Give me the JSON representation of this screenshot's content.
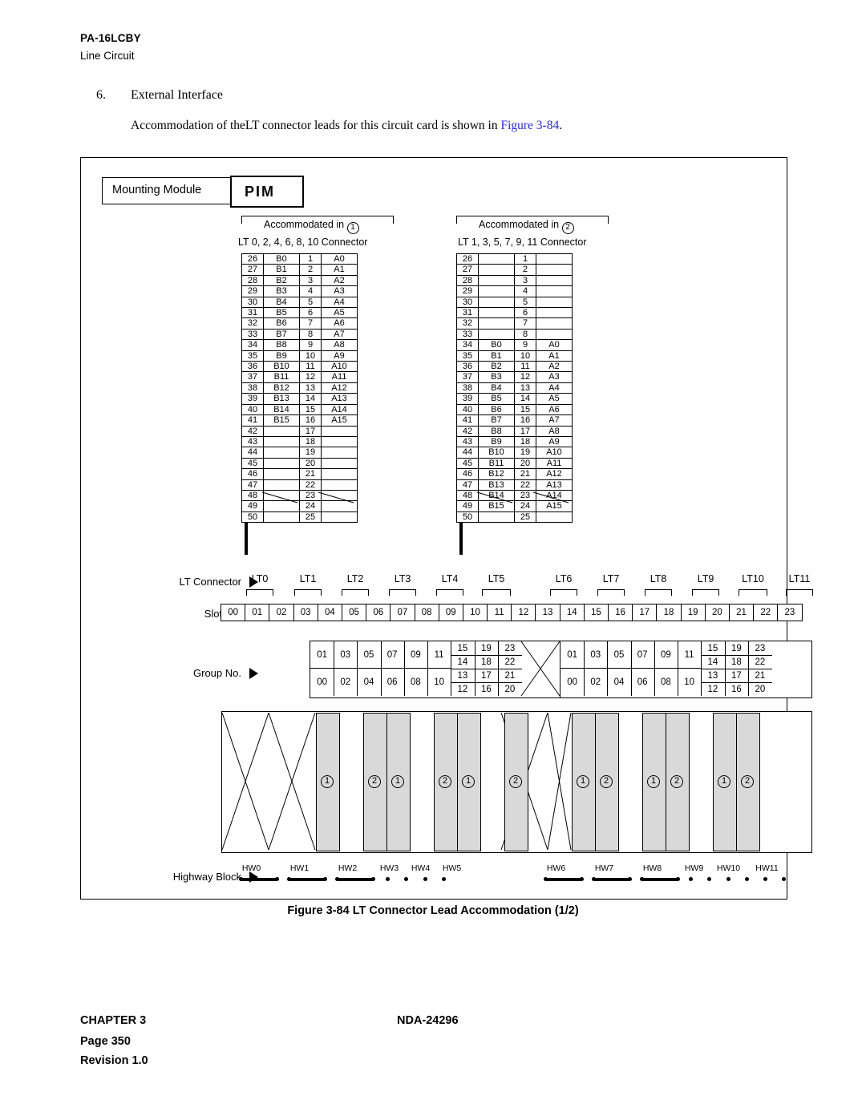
{
  "header": {
    "title": "PA-16LCBY",
    "subtitle": "Line Circuit"
  },
  "section": {
    "number": "6.",
    "title": "External Interface",
    "paragraph_before": "Accommodation of the",
    "paragraph_lt": "LT",
    "paragraph_mid": " connector leads for this circuit card is shown in ",
    "figure_ref": "Figure 3-84",
    "paragraph_end": "."
  },
  "figure": {
    "mounting_module_label": "Mounting Module",
    "pim_label": "PIM",
    "caption": "Figure 3-84  LT Connector Lead Accommodation (1/2)",
    "accommodated_left": "Accommodated in",
    "accommodated_left_circle": "1",
    "accommodated_right": "Accommodated in",
    "accommodated_right_circle": "2",
    "connector_left_title": "LT 0, 2, 4, 6, 8, 10 Connector",
    "connector_right_title": "LT 1, 3, 5, 7, 9, 11 Connector",
    "connector_left_rows": [
      [
        "26",
        "B0",
        "1",
        "A0"
      ],
      [
        "27",
        "B1",
        "2",
        "A1"
      ],
      [
        "28",
        "B2",
        "3",
        "A2"
      ],
      [
        "29",
        "B3",
        "4",
        "A3"
      ],
      [
        "30",
        "B4",
        "5",
        "A4"
      ],
      [
        "31",
        "B5",
        "6",
        "A5"
      ],
      [
        "32",
        "B6",
        "7",
        "A6"
      ],
      [
        "33",
        "B7",
        "8",
        "A7"
      ],
      [
        "34",
        "B8",
        "9",
        "A8"
      ],
      [
        "35",
        "B9",
        "10",
        "A9"
      ],
      [
        "36",
        "B10",
        "11",
        "A10"
      ],
      [
        "37",
        "B11",
        "12",
        "A11"
      ],
      [
        "38",
        "B12",
        "13",
        "A12"
      ],
      [
        "39",
        "B13",
        "14",
        "A13"
      ],
      [
        "40",
        "B14",
        "15",
        "A14"
      ],
      [
        "41",
        "B15",
        "16",
        "A15"
      ],
      [
        "42",
        "",
        "17",
        ""
      ],
      [
        "43",
        "",
        "18",
        ""
      ],
      [
        "44",
        "",
        "19",
        ""
      ],
      [
        "45",
        "",
        "20",
        ""
      ],
      [
        "46",
        "",
        "21",
        ""
      ],
      [
        "47",
        "",
        "22",
        ""
      ],
      [
        "48",
        "",
        "23",
        ""
      ],
      [
        "49",
        "",
        "24",
        ""
      ],
      [
        "50",
        "",
        "25",
        ""
      ]
    ],
    "connector_right_rows": [
      [
        "26",
        "",
        "1",
        ""
      ],
      [
        "27",
        "",
        "2",
        ""
      ],
      [
        "28",
        "",
        "3",
        ""
      ],
      [
        "29",
        "",
        "4",
        ""
      ],
      [
        "30",
        "",
        "5",
        ""
      ],
      [
        "31",
        "",
        "6",
        ""
      ],
      [
        "32",
        "",
        "7",
        ""
      ],
      [
        "33",
        "",
        "8",
        ""
      ],
      [
        "34",
        "B0",
        "9",
        "A0"
      ],
      [
        "35",
        "B1",
        "10",
        "A1"
      ],
      [
        "36",
        "B2",
        "11",
        "A2"
      ],
      [
        "37",
        "B3",
        "12",
        "A3"
      ],
      [
        "38",
        "B4",
        "13",
        "A4"
      ],
      [
        "39",
        "B5",
        "14",
        "A5"
      ],
      [
        "40",
        "B6",
        "15",
        "A6"
      ],
      [
        "41",
        "B7",
        "16",
        "A7"
      ],
      [
        "42",
        "B8",
        "17",
        "A8"
      ],
      [
        "43",
        "B9",
        "18",
        "A9"
      ],
      [
        "44",
        "B10",
        "19",
        "A10"
      ],
      [
        "45",
        "B11",
        "20",
        "A11"
      ],
      [
        "46",
        "B12",
        "21",
        "A12"
      ],
      [
        "47",
        "B13",
        "22",
        "A13"
      ],
      [
        "48",
        "B14",
        "23",
        "A14"
      ],
      [
        "49",
        "B15",
        "24",
        "A15"
      ],
      [
        "50",
        "",
        "25",
        ""
      ]
    ],
    "row_labels": [
      "LT Connector",
      "Slot No.",
      "Group No.",
      "PIM",
      "Highway Block"
    ],
    "lt_labels": [
      "LT0",
      "LT1",
      "LT2",
      "LT3",
      "LT4",
      "LT5",
      "LT6",
      "LT7",
      "LT8",
      "LT9",
      "LT10",
      "LT11"
    ],
    "slot_numbers": [
      "00",
      "01",
      "02",
      "03",
      "04",
      "05",
      "06",
      "07",
      "08",
      "09",
      "10",
      "11",
      "12",
      "13",
      "14",
      "15",
      "16",
      "17",
      "18",
      "19",
      "20",
      "21",
      "22",
      "23"
    ],
    "group_left_top": [
      "01",
      "03",
      "05",
      "07",
      "09",
      "11"
    ],
    "group_left_bottom": [
      "00",
      "02",
      "04",
      "06",
      "08",
      "10"
    ],
    "group_left_matrix_top": [
      "15",
      "19",
      "23"
    ],
    "group_left_matrix_row2": [
      "14",
      "18",
      "22"
    ],
    "group_left_matrix_row3": [
      "13",
      "17",
      "21"
    ],
    "group_left_matrix_bottom": [
      "12",
      "16",
      "20"
    ],
    "group_right_top": [
      "01",
      "03",
      "05",
      "07",
      "09",
      "11"
    ],
    "group_right_bottom": [
      "00",
      "02",
      "04",
      "06",
      "08",
      "10"
    ],
    "group_right_matrix_top": [
      "15",
      "19",
      "23"
    ],
    "group_right_matrix_row2": [
      "14",
      "18",
      "22"
    ],
    "group_right_matrix_row3": [
      "13",
      "17",
      "21"
    ],
    "group_right_matrix_bottom": [
      "12",
      "16",
      "20"
    ],
    "pim_card_numbers": [
      "1",
      "2",
      "1",
      "2",
      "1",
      "2",
      "1",
      "2",
      "1",
      "2",
      "1",
      "2"
    ],
    "highway_labels": [
      "HW0",
      "HW1",
      "HW2",
      "HW3",
      "HW4",
      "HW5",
      "HW6",
      "HW7",
      "HW8",
      "HW9",
      "HW10",
      "HW11"
    ]
  },
  "footer": {
    "chapter_label": "CHAPTER",
    "chapter_number": "3",
    "document": "NDA-24296",
    "page_label": "Page",
    "page_number": "350",
    "revision_label": "Revision",
    "revision_number": "1.0"
  }
}
